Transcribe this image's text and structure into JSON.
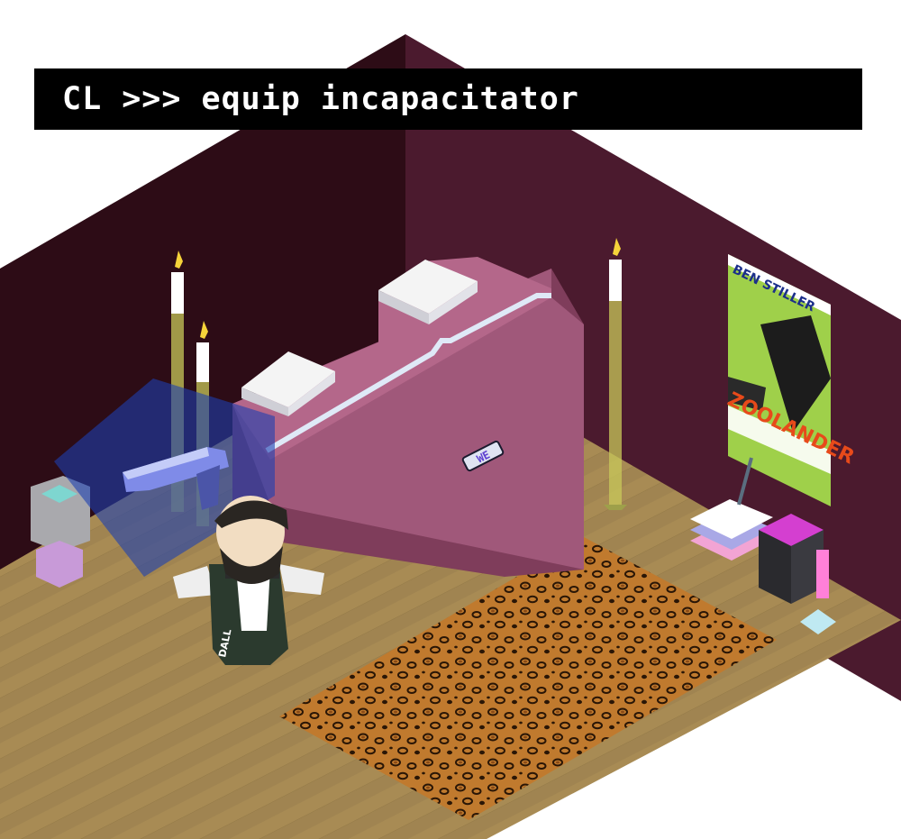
{
  "command": {
    "prompt": "CL >>>",
    "text": "equip incapacitator",
    "full": "CL >>> equip incapacitator"
  },
  "poster": {
    "top_text": "BEN STILLER",
    "title": "ZOOLANDER"
  },
  "character": {
    "name_tag": "DALL"
  },
  "colors": {
    "wall_left": "#2d0c16",
    "wall_right": "#4b1a2e",
    "floor": "#a58a54",
    "bed": "#a0587a",
    "rug": "#b8742c",
    "selection": "#1c3fb0",
    "command_bg": "#000000",
    "command_fg": "#ffffff"
  },
  "icons": {
    "weapon": "incapacitator-gun-icon",
    "item_pickup": "floor-item-icon",
    "candle": "candle-icon"
  }
}
